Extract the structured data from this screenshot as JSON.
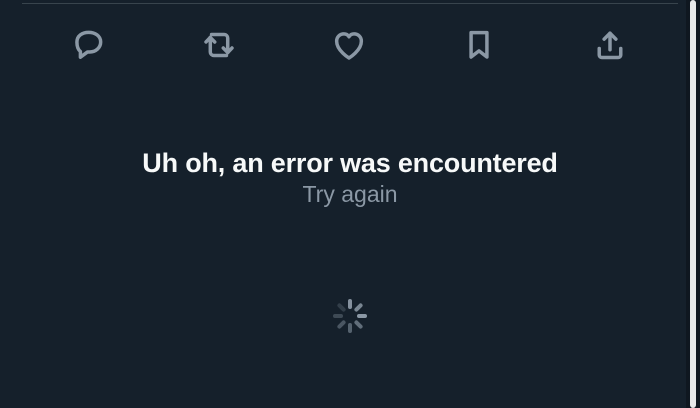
{
  "actions": [
    {
      "name": "reply",
      "icon": "comment-icon"
    },
    {
      "name": "retweet",
      "icon": "retweet-icon"
    },
    {
      "name": "like",
      "icon": "heart-icon"
    },
    {
      "name": "bookmark",
      "icon": "bookmark-icon"
    },
    {
      "name": "share",
      "icon": "share-icon"
    }
  ],
  "error": {
    "title": "Uh oh, an error was encountered",
    "retry_label": "Try again"
  },
  "loading": {
    "icon": "spinner-icon"
  },
  "colors": {
    "background": "#15202b",
    "text_primary": "#f7f9f9",
    "icon_color": "#8b98a5",
    "divider": "#38444d"
  }
}
